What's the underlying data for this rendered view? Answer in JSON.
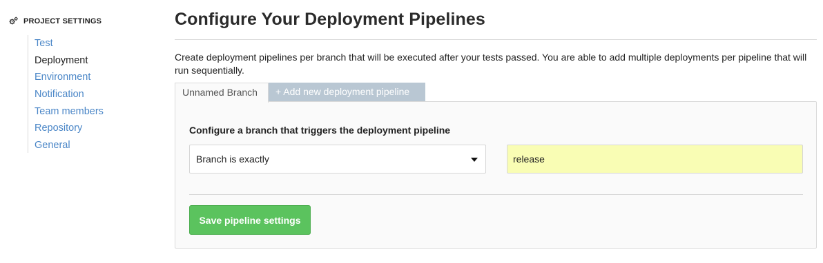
{
  "sidebar": {
    "header_label": "PROJECT SETTINGS",
    "header_icon": "gears-icon",
    "items": [
      {
        "label": "Test",
        "active": false
      },
      {
        "label": "Deployment",
        "active": true
      },
      {
        "label": "Environment",
        "active": false
      },
      {
        "label": "Notification",
        "active": false
      },
      {
        "label": "Team members",
        "active": false
      },
      {
        "label": "Repository",
        "active": false
      },
      {
        "label": "General",
        "active": false
      }
    ]
  },
  "main": {
    "title": "Configure Your Deployment Pipelines",
    "description": "Create deployment pipelines per branch that will be executed after your tests passed. You are able to add multiple deployments per pipeline that will run sequentially.",
    "tabs": {
      "active_label": "Unnamed Branch",
      "add_label": "+ Add new deployment pipeline"
    },
    "panel": {
      "label": "Configure a branch that triggers the deployment pipeline",
      "branch_match_selected": "Branch is exactly",
      "branch_value": "release",
      "save_label": "Save pipeline settings"
    }
  },
  "colors": {
    "link": "#4a86c7",
    "accent_green": "#5bc35e",
    "input_highlight": "#f9fdb4",
    "tab_add_bg": "#b9c7d3"
  }
}
